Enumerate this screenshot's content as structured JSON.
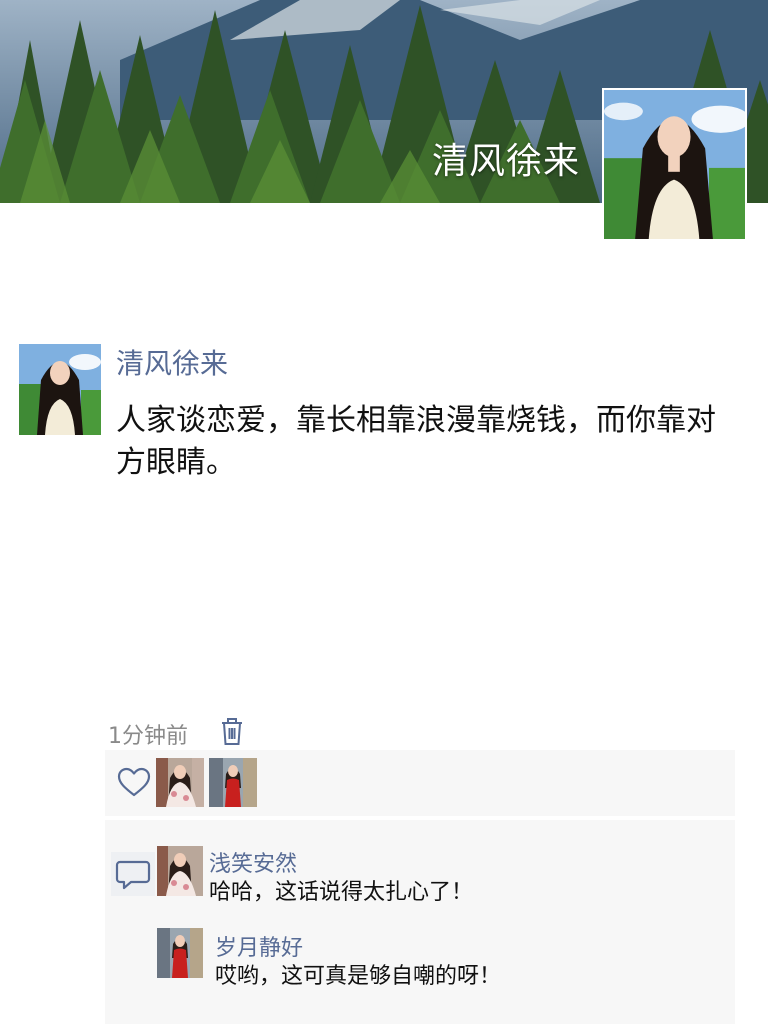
{
  "cover": {
    "display_name": "清风徐来",
    "background_icon": "forest-mountain-scenery"
  },
  "post": {
    "author": "清风徐来",
    "text": "人家谈恋爱，靠长相靠浪漫靠烧钱，而你靠对方眼睛。",
    "time": "1分钟前",
    "delete_icon": "trash-icon"
  },
  "likes": {
    "icon": "heart-icon",
    "users": [
      "like-user-1",
      "like-user-2"
    ]
  },
  "comments": {
    "icon": "comment-icon",
    "items": [
      {
        "name": "浅笑安然",
        "text": "哈哈，这话说得太扎心了！"
      },
      {
        "name": "岁月静好",
        "text": "哎哟，这可真是够自嘲的呀！"
      }
    ]
  },
  "colors": {
    "link_blue": "#576b95",
    "panel_bg": "#f7f7f7",
    "time_gray": "#8a8a8a"
  }
}
